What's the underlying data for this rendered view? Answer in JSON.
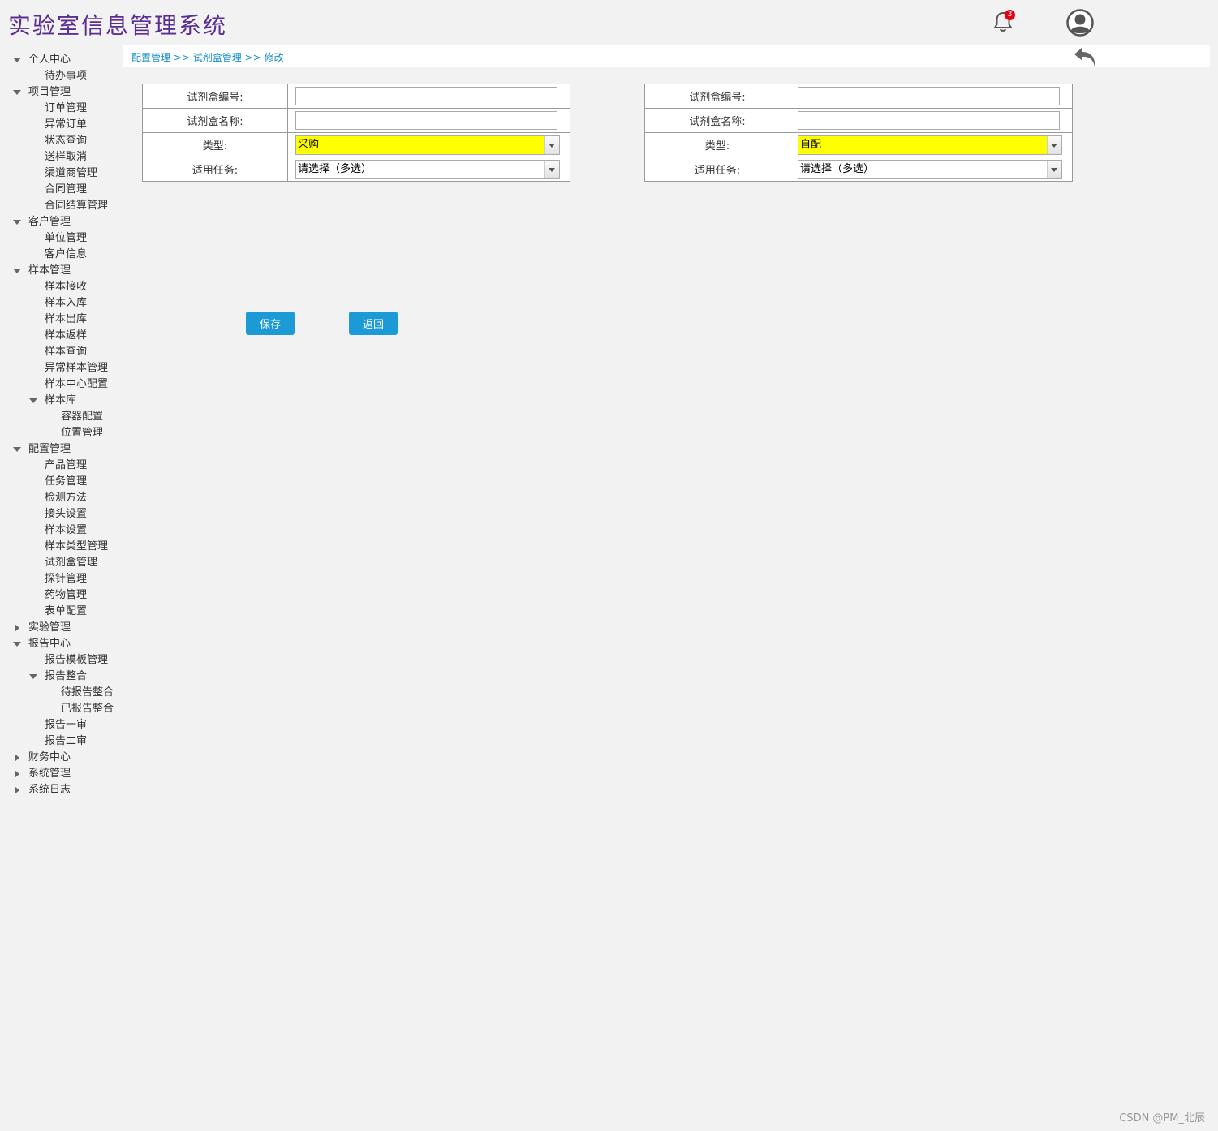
{
  "header": {
    "title": "实验室信息管理系统",
    "notification_count": "3",
    "bell_icon": "bell-icon",
    "avatar_icon": "user-avatar-icon",
    "back_icon": "reply-arrow-icon"
  },
  "breadcrumb": {
    "items": [
      "配置管理",
      "试剂盒管理",
      "修改"
    ],
    "separator": ">>"
  },
  "sidebar": {
    "items": [
      {
        "label": "个人中心",
        "level": 0,
        "toggle": "expanded"
      },
      {
        "label": "待办事项",
        "level": 1
      },
      {
        "label": "项目管理",
        "level": 0,
        "toggle": "expanded"
      },
      {
        "label": "订单管理",
        "level": 1
      },
      {
        "label": "异常订单",
        "level": 1
      },
      {
        "label": "状态查询",
        "level": 1
      },
      {
        "label": "送样取消",
        "level": 1
      },
      {
        "label": "渠道商管理",
        "level": 1
      },
      {
        "label": "合同管理",
        "level": 1
      },
      {
        "label": "合同结算管理",
        "level": 1
      },
      {
        "label": "客户管理",
        "level": 0,
        "toggle": "expanded"
      },
      {
        "label": "单位管理",
        "level": 1
      },
      {
        "label": "客户信息",
        "level": 1
      },
      {
        "label": "样本管理",
        "level": 0,
        "toggle": "expanded"
      },
      {
        "label": "样本接收",
        "level": 1
      },
      {
        "label": "样本入库",
        "level": 1
      },
      {
        "label": "样本出库",
        "level": 1
      },
      {
        "label": "样本返样",
        "level": 1
      },
      {
        "label": "样本查询",
        "level": 1
      },
      {
        "label": "异常样本管理",
        "level": 1
      },
      {
        "label": "样本中心配置",
        "level": 1
      },
      {
        "label": "样本库",
        "level": 1,
        "toggle": "expanded"
      },
      {
        "label": "容器配置",
        "level": 2
      },
      {
        "label": "位置管理",
        "level": 2
      },
      {
        "label": "配置管理",
        "level": 0,
        "toggle": "expanded"
      },
      {
        "label": "产品管理",
        "level": 1
      },
      {
        "label": "任务管理",
        "level": 1
      },
      {
        "label": "检测方法",
        "level": 1
      },
      {
        "label": "接头设置",
        "level": 1
      },
      {
        "label": "样本设置",
        "level": 1
      },
      {
        "label": "样本类型管理",
        "level": 1
      },
      {
        "label": "试剂盒管理",
        "level": 1
      },
      {
        "label": "探针管理",
        "level": 1
      },
      {
        "label": "药物管理",
        "level": 1
      },
      {
        "label": "表单配置",
        "level": 1
      },
      {
        "label": "实验管理",
        "level": 0,
        "toggle": "collapsed"
      },
      {
        "label": "报告中心",
        "level": 0,
        "toggle": "expanded"
      },
      {
        "label": "报告模板管理",
        "level": 1
      },
      {
        "label": "报告整合",
        "level": 1,
        "toggle": "expanded"
      },
      {
        "label": "待报告整合",
        "level": 2
      },
      {
        "label": "已报告整合",
        "level": 2
      },
      {
        "label": "报告一审",
        "level": 1
      },
      {
        "label": "报告二审",
        "level": 1
      },
      {
        "label": "财务中心",
        "level": 0,
        "toggle": "collapsed"
      },
      {
        "label": "系统管理",
        "level": 0,
        "toggle": "collapsed"
      },
      {
        "label": "系统日志",
        "level": 0,
        "toggle": "collapsed"
      }
    ]
  },
  "forms": [
    {
      "code_label": "试剂盒编号:",
      "code_value": "",
      "name_label": "试剂盒名称:",
      "name_value": "",
      "type_label": "类型:",
      "type_value": "采购",
      "task_label": "适用任务:",
      "task_value": "请选择（多选）"
    },
    {
      "code_label": "试剂盒编号:",
      "code_value": "",
      "name_label": "试剂盒名称:",
      "name_value": "",
      "type_label": "类型:",
      "type_value": "自配",
      "task_label": "适用任务:",
      "task_value": "请选择（多选）"
    }
  ],
  "actions": {
    "save_label": "保存",
    "back_label": "返回"
  },
  "watermark": "CSDN @PM_北辰",
  "colors": {
    "title": "#5b2e91",
    "link": "#1a8fc7",
    "button": "#1c9ad6",
    "highlight": "#ffff00",
    "badge": "#e60012"
  }
}
